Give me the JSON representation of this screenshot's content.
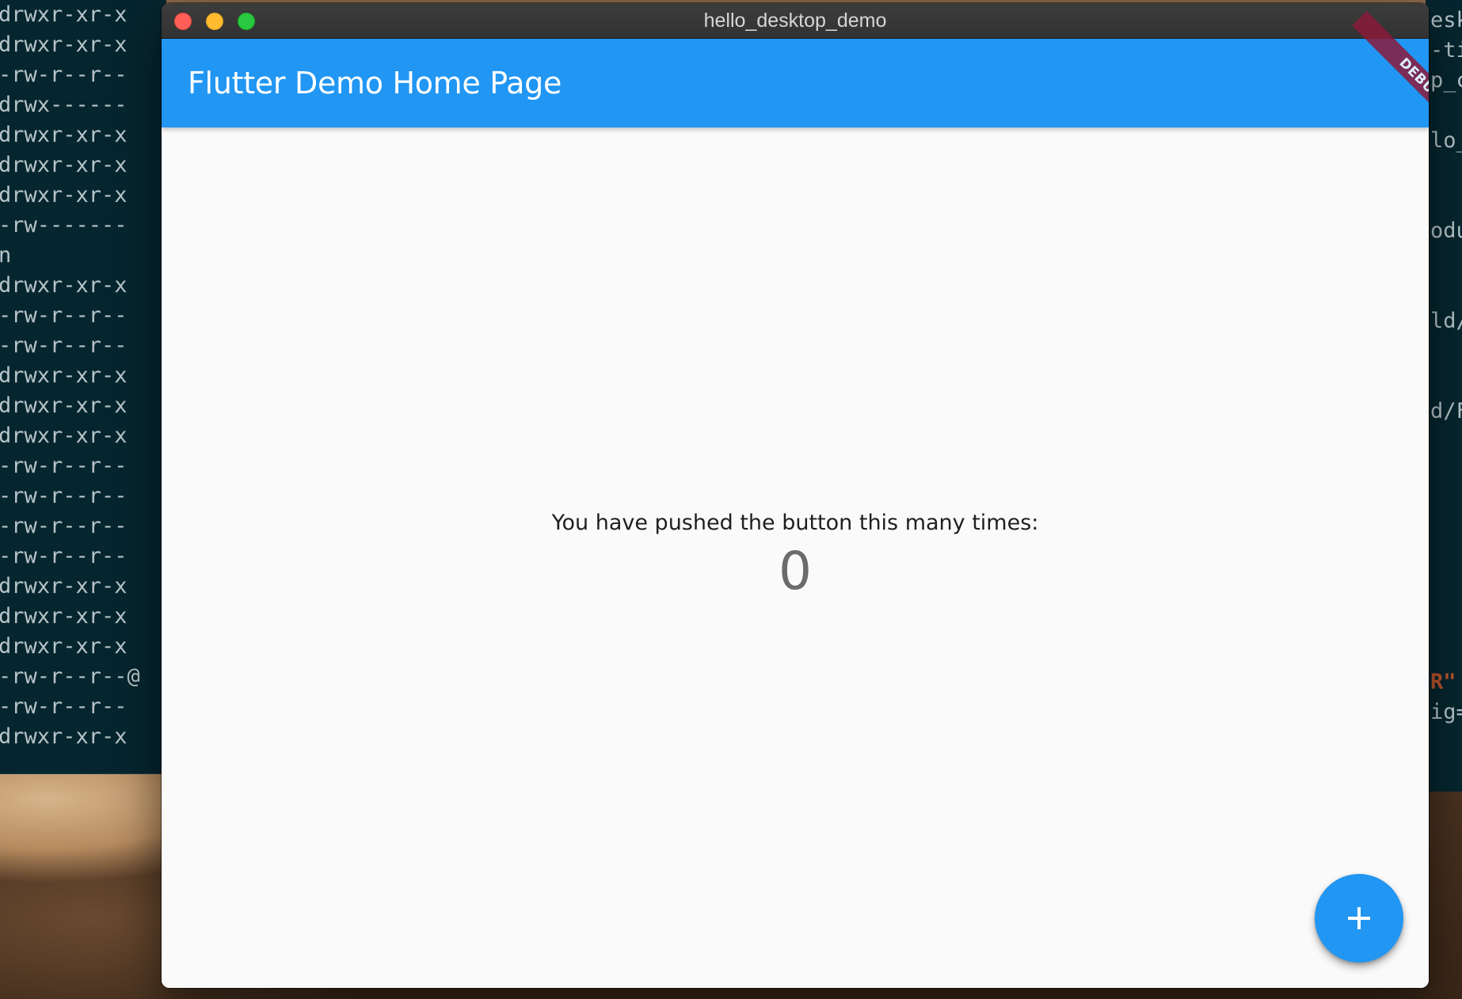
{
  "window": {
    "title": "hello_desktop_demo"
  },
  "app_bar": {
    "title": "Flutter Demo Home Page"
  },
  "debug_banner": {
    "label": "DEBUG"
  },
  "counter": {
    "message": "You have pushed the button this many times:",
    "value": "0"
  },
  "fab": {
    "icon": "add-icon"
  },
  "terminal_left": {
    "lines": [
      "drwxr-xr-x",
      "drwxr-xr-x",
      "-rw-r--r--",
      "drwx------",
      "drwxr-xr-x",
      "drwxr-xr-x",
      "drwxr-xr-x",
      "-rw-------",
      "n",
      "drwxr-xr-x",
      "-rw-r--r--",
      "-rw-r--r--",
      "drwxr-xr-x",
      "drwxr-xr-x",
      "drwxr-xr-x",
      "-rw-r--r--",
      "-rw-r--r--",
      "-rw-r--r--",
      "-rw-r--r--",
      "drwxr-xr-x",
      "drwxr-xr-x",
      "drwxr-xr-x",
      "-rw-r--r--@",
      "-rw-r--r--",
      "drwxr-xr-x"
    ]
  },
  "terminal_right": {
    "fragments": [
      "esk",
      "-ti",
      "p_c",
      "lo_",
      "odu",
      "ld/",
      "d/F",
      "R\"",
      "ig="
    ]
  },
  "colors": {
    "primary": "#2196f3",
    "debug_banner": "#8a1c3a",
    "background": "#fafafa",
    "terminal_bg": "#06262f"
  }
}
